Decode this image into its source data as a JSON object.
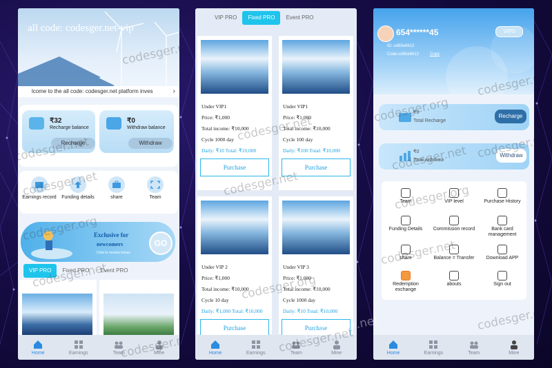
{
  "colors": {
    "accent": "#1fc4ec",
    "brand_blue": "#2a8be0",
    "link_blue": "#1fa0e0",
    "background": "#160c45"
  },
  "watermark": "codesger.net",
  "watermark_alt": "codesger.org",
  "bottom_nav": [
    {
      "label": "Home",
      "icon": "home-icon"
    },
    {
      "label": "Earnings",
      "icon": "grid-icon"
    },
    {
      "label": "Team",
      "icon": "team-icon"
    },
    {
      "label": "Mine",
      "icon": "user-icon"
    }
  ],
  "home": {
    "hero_title": "all code: codesger.net-vip",
    "marquee": "lcome to the all code: codesger.net platform inves",
    "recharge": {
      "value": "₹32",
      "label": "Recharge balance",
      "button": "Recharge"
    },
    "withdraw": {
      "value": "₹0",
      "label": "Withdraw balance",
      "button": "Withdraw"
    },
    "quick_actions": [
      "Earnings record",
      "Funding details",
      "share",
      "Team"
    ],
    "promo": {
      "title": "Exclusive for",
      "subtitle": "newcomers",
      "hint": "Click to receive bonus",
      "go": "GO"
    },
    "tabs": [
      "VIP PRO",
      "Fixed PRO",
      "Event PRO"
    ]
  },
  "fixed": {
    "tabs": [
      "VIP PRO",
      "Fixed PRO",
      "Event PRO"
    ],
    "products": [
      {
        "name": "Under VIP1",
        "price": "Price: ₹1,000",
        "income": "Total income: ₹10,000",
        "cycle": "Cycle 1000 day",
        "daily": "Daily: ₹10   Total: ₹10,000",
        "button": "Purchase"
      },
      {
        "name": "Under VIP1",
        "price": "Price: ₹1,000",
        "income": "Total income: ₹10,000",
        "cycle": "Cycle 100 day",
        "daily": "Daily: ₹100   Total: ₹10,000",
        "button": "Purchase"
      },
      {
        "name": "Under VIP 2",
        "price": "Price: ₹1,000",
        "income": "Total income: ₹10,000",
        "cycle": "Cycle 10 day",
        "daily": "Daily: ₹1,000   Total: ₹10,000",
        "button": "Purchase"
      },
      {
        "name": "Under VIP 3",
        "price": "Price: ₹1,000",
        "income": "Total income: ₹10,000",
        "cycle": "Cycle 1000 day",
        "daily": "Daily: ₹10   Total: ₹10,000",
        "button": "Purchase"
      }
    ]
  },
  "mine": {
    "username": "654******45",
    "vip": "VIP0",
    "id_line": "ID: ud65e6612",
    "code_line": "Code:ud65e6612",
    "copy": "Copy",
    "recharge": {
      "value": "₹0",
      "label": "Total Recharge",
      "button": "Recharge"
    },
    "withdraw": {
      "value": "₹0",
      "label": "Total withdraw",
      "button": "Withdraw"
    },
    "menu": [
      "Team",
      "VIP level",
      "Purchase History",
      "Funding Details",
      "Commission record",
      "Bank card management",
      "share",
      "Balance = Transfer",
      "Download APP",
      "Redemption exchange",
      "abouts",
      "Sign out"
    ]
  }
}
